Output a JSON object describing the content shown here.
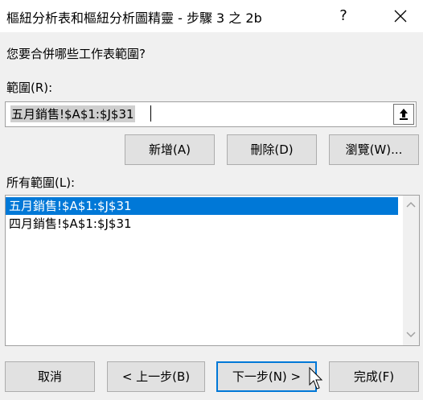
{
  "window": {
    "title": "樞紐分析表和樞紐分析圖精靈 - 步驟 3 之 2b",
    "help_label": "?"
  },
  "prompt": "您要合併哪些工作表範圍?",
  "range": {
    "label": "範圍(R):",
    "value": "五月銷售!$A$1:$J$31"
  },
  "buttons": {
    "add": "新增(A)",
    "delete": "刪除(D)",
    "browse": "瀏覽(W)...",
    "cancel": "取消",
    "back": "< 上一步(B)",
    "next": "下一步(N) >",
    "finish": "完成(F)"
  },
  "all_ranges": {
    "label": "所有範圍(L):",
    "items": [
      {
        "label": "五月銷售!$A$1:$J$31",
        "selected": true
      },
      {
        "label": "四月銷售!$A$1:$J$31",
        "selected": false
      }
    ]
  },
  "colors": {
    "accent": "#0078d7",
    "window_bg": "#f0f0f0",
    "button_bg": "#e1e1e1"
  }
}
